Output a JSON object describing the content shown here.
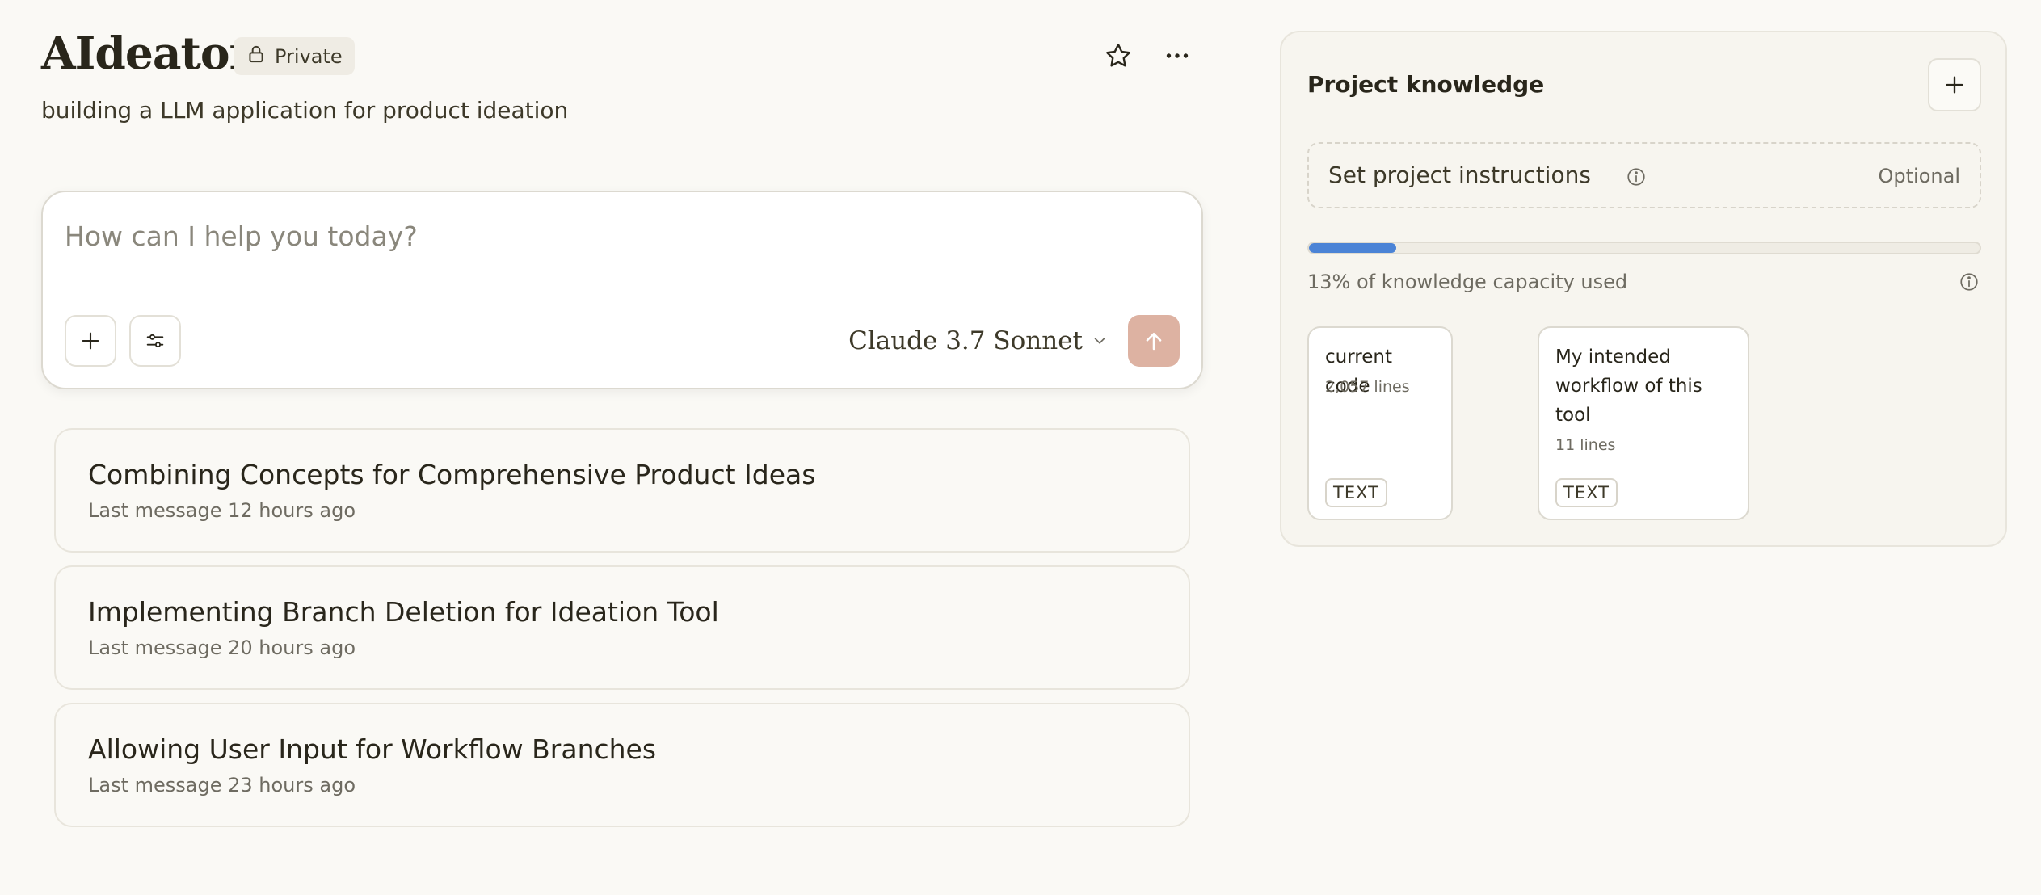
{
  "header": {
    "title": "AIdeator",
    "privacy_label": "Private",
    "description": "building a LLM application for product ideation"
  },
  "composer": {
    "placeholder": "How can I help you today?",
    "model": "Claude 3.7 Sonnet"
  },
  "conversations": [
    {
      "title": "Combining Concepts for Comprehensive Product Ideas",
      "subtitle": "Last message 12 hours ago"
    },
    {
      "title": "Implementing Branch Deletion for Ideation Tool",
      "subtitle": "Last message 20 hours ago"
    },
    {
      "title": "Allowing User Input for Workflow Branches",
      "subtitle": "Last message 23 hours ago"
    }
  ],
  "knowledge": {
    "title": "Project knowledge",
    "instructions_label": "Set project instructions",
    "instructions_optional": "Optional",
    "capacity_fraction": 0.13,
    "capacity_label": "13% of knowledge capacity used",
    "documents": [
      {
        "name": "current code",
        "lines": "2,057 lines",
        "type": "TEXT"
      },
      {
        "name": "My intended workflow of this tool",
        "lines": "11 lines",
        "type": "TEXT"
      }
    ]
  },
  "colors": {
    "background": "#faf9f5",
    "send_button": "#ddb2a2",
    "capacity_fill": "#4b83d6"
  },
  "icons": [
    "lock-icon",
    "star-icon",
    "more-icon",
    "plus-icon",
    "sliders-icon",
    "chevron-down-icon",
    "arrow-up-icon",
    "info-icon"
  ]
}
